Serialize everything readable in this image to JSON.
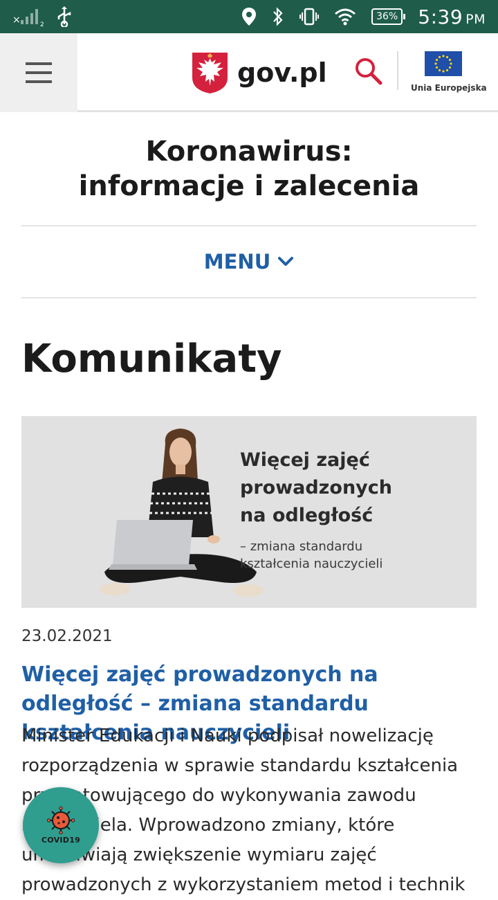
{
  "status_bar": {
    "time": "5:39",
    "ampm": "PM",
    "battery": "36%",
    "icons": [
      "signal-off-icon",
      "usb-icon",
      "location-icon",
      "bluetooth-icon",
      "vibrate-icon",
      "wifi-icon",
      "battery-icon"
    ]
  },
  "header": {
    "logo_text": "gov.pl",
    "eu_label": "Unia Europejska",
    "icons": [
      "hamburger-menu-icon",
      "polish-eagle-emblem",
      "search-icon",
      "eu-flag-icon"
    ]
  },
  "page": {
    "title_line1": "Koronawirus:",
    "title_line2": "informacje i zalecenia",
    "menu_label": "MENU",
    "section_title": "Komunikaty"
  },
  "article": {
    "image_headline_line1": "Więcej zajęć",
    "image_headline_line2": "prowadzonych",
    "image_headline_line3": "na odległość",
    "image_sub_line1": "– zmiana standardu",
    "image_sub_line2": "kształcenia nauczycieli",
    "date": "23.02.2021",
    "title": "Więcej zajęć prowadzonych na odległość – zmiana standardu kształcenia nauczycieli",
    "excerpt": "Minister Edukacji i Nauki podpisał nowelizację rozporządzenia w sprawie standardu kształcenia przygotowującego do wykonywania zawodu nauczyciela. Wprowadzono zmiany, które umożliwiają zwiększenie wymiaru zajęć prowadzonych z wykorzystaniem metod i technik"
  },
  "fab": {
    "label": "COVID19"
  },
  "colors": {
    "status_bar": "#1f5c4a",
    "link_blue": "#1f5fa6",
    "search_red": "#d4213d",
    "fab_teal": "#2f9e8f"
  }
}
